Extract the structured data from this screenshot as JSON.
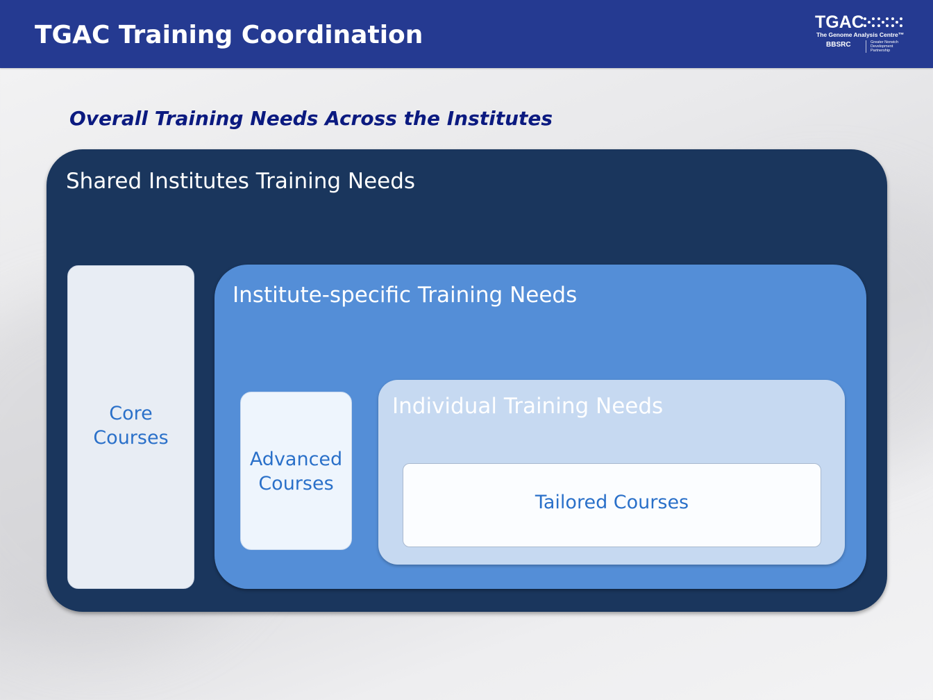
{
  "header": {
    "title": "TGAC Training Coordination",
    "logo": {
      "main": "TGAC",
      "sub": "The Genome Analysis Centre™",
      "bbsrc": "BBSRC",
      "partner_lines": "Greater Norwich\nDevelopment\nPartnership"
    }
  },
  "subtitle": "Overall Training Needs Across the Institutes",
  "diagram": {
    "shared": {
      "label": "Shared Institutes Training Needs",
      "color": "#1a365d"
    },
    "core": {
      "label_line1": "Core",
      "label_line2": "Courses"
    },
    "institute": {
      "label": "Institute-specific Training Needs",
      "color": "#548ed7"
    },
    "advanced": {
      "label_line1": "Advanced",
      "label_line2": "Courses"
    },
    "individual": {
      "label": "Individual Training Needs",
      "color": "#c6d9f1"
    },
    "tailored": {
      "label": "Tailored Courses"
    }
  },
  "colors": {
    "header_bg": "#253a91",
    "subtitle": "#0b1a80",
    "course_text": "#2a70c9"
  }
}
